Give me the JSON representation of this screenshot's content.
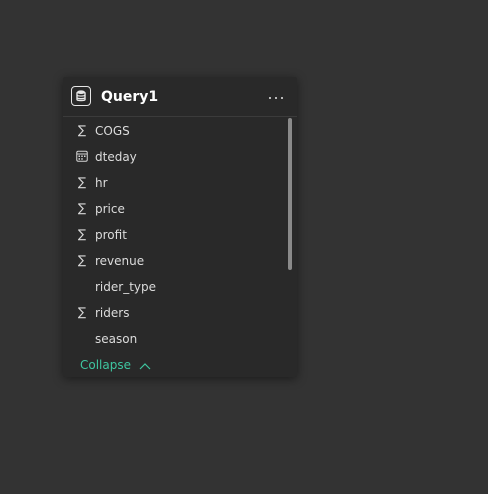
{
  "card": {
    "title": "Query1",
    "table_icon": "table-database-icon",
    "more_icon": "more-options-icon"
  },
  "fields": [
    {
      "label": "COGS",
      "icon": "sigma-icon"
    },
    {
      "label": "dteday",
      "icon": "calendar-icon"
    },
    {
      "label": "hr",
      "icon": "sigma-icon"
    },
    {
      "label": "price",
      "icon": "sigma-icon"
    },
    {
      "label": "profit",
      "icon": "sigma-icon"
    },
    {
      "label": "revenue",
      "icon": "sigma-icon"
    },
    {
      "label": "rider_type",
      "icon": ""
    },
    {
      "label": "riders",
      "icon": "sigma-icon"
    },
    {
      "label": "season",
      "icon": ""
    }
  ],
  "footer": {
    "collapse_label": "Collapse",
    "collapse_icon": "chevron-up-icon"
  },
  "colors": {
    "background": "#333333",
    "card": "#292929",
    "accent": "#3ec6a0",
    "text": "#dcdcdc"
  }
}
